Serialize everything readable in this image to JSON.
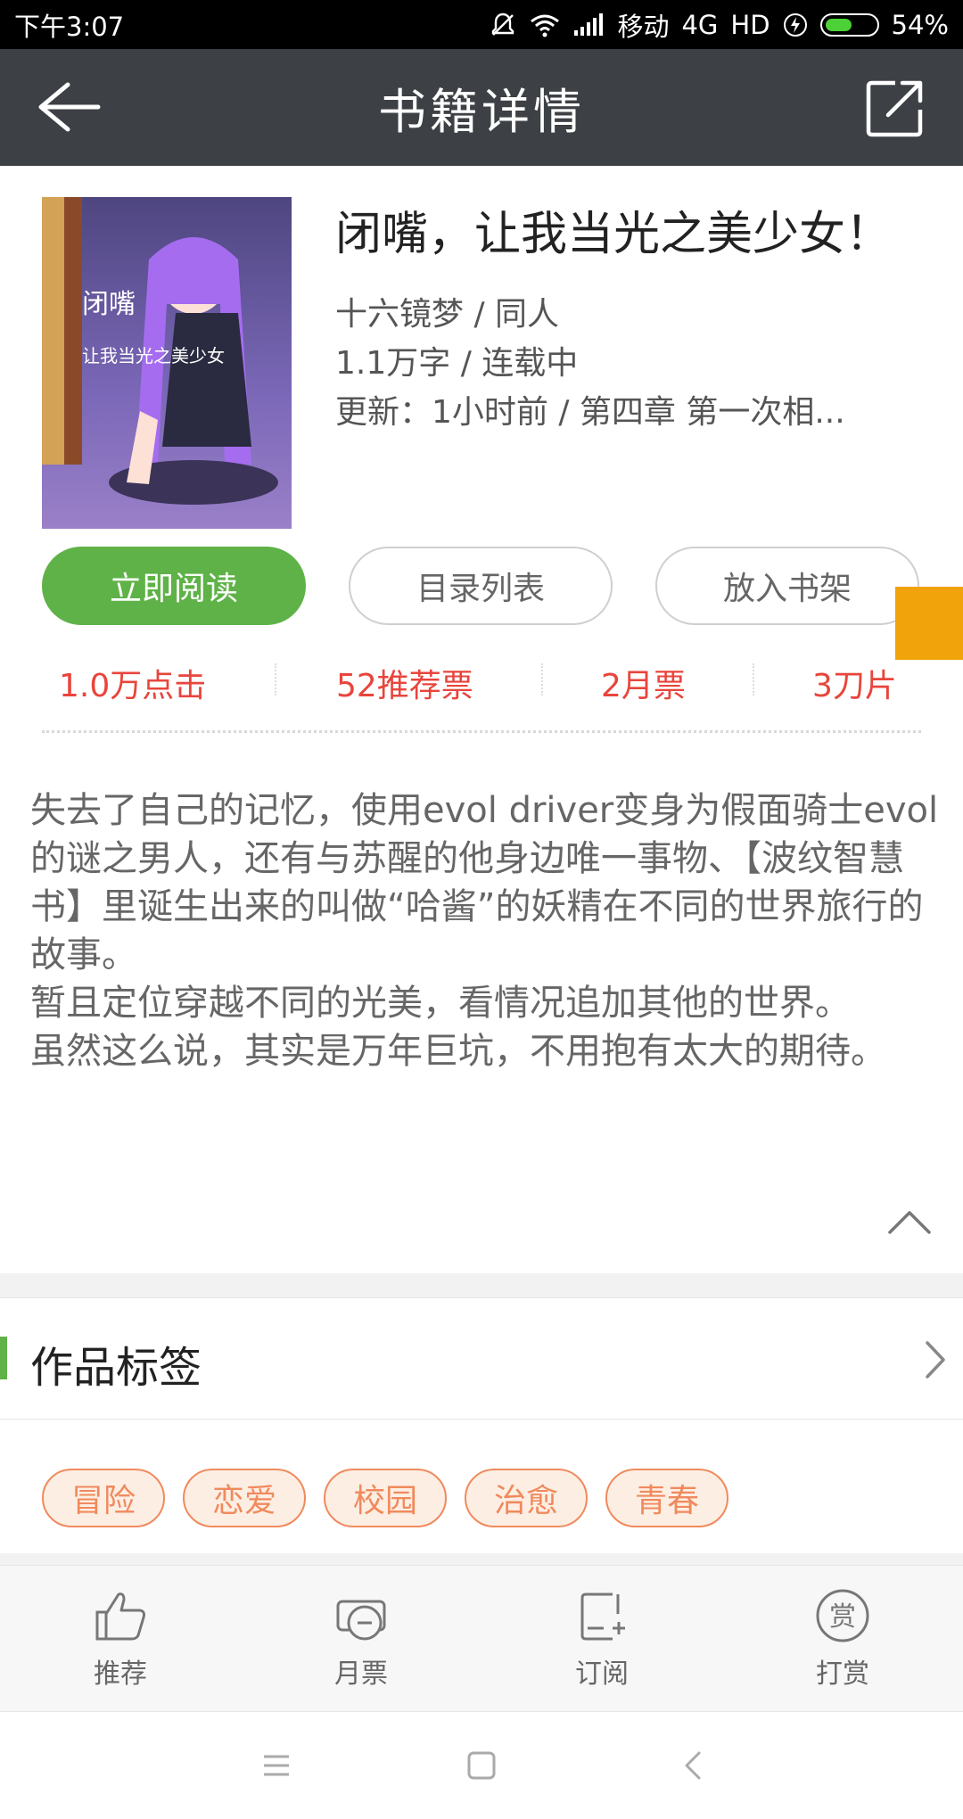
{
  "status_bar": {
    "time": "下午3:07",
    "carrier": "移动",
    "network": "4G",
    "hd": "HD",
    "battery_percent": "54%",
    "battery_level": 0.54
  },
  "app_bar": {
    "title": "书籍详情",
    "back_icon": "arrow-left-icon",
    "share_icon": "share-icon"
  },
  "book": {
    "title": "闭嘴，让我当光之美少女！",
    "author_category": "十六镜梦 / 同人",
    "words_status": "1.1万字 / 连载中",
    "update": "更新：1小时前 / 第四章 第一次相...",
    "cover": {
      "title_line1": "闭嘴",
      "title_line2": "让我当光之美少女"
    }
  },
  "buttons": {
    "read": "立即阅读",
    "catalog": "目录列表",
    "shelf": "放入书架"
  },
  "stats": [
    {
      "label": "1.0万点击"
    },
    {
      "label": "52推荐票"
    },
    {
      "label": "2月票"
    },
    {
      "label": "3刀片"
    }
  ],
  "description": [
    "失去了自己的记忆，使用evol driver变身为假面骑士evol的谜之男人，还有与苏醒的他身边唯一事物、【波纹智慧书】里诞生出来的叫做“哈酱”的妖精在不同的世界旅行的故事。",
    "暂且定位穿越不同的光美，看情况追加其他的世界。",
    "虽然这么说，其实是万年巨坑，不用抱有太大的期待。"
  ],
  "tags_section": {
    "title": "作品标签",
    "tags": [
      "冒险",
      "恋爱",
      "校园",
      "治愈",
      "青春"
    ]
  },
  "actions": [
    {
      "label": "推荐",
      "icon": "thumbs-up-icon"
    },
    {
      "label": "月票",
      "icon": "ticket-icon"
    },
    {
      "label": "订阅",
      "icon": "subscribe-icon"
    },
    {
      "label": "打赏",
      "icon": "reward-icon"
    }
  ],
  "colors": {
    "app_bar": "#3d4145",
    "primary_green": "#5fb247",
    "stat_red": "#e8453c",
    "tag_orange": "#f08a5d",
    "side_tab": "#f0a30a"
  }
}
